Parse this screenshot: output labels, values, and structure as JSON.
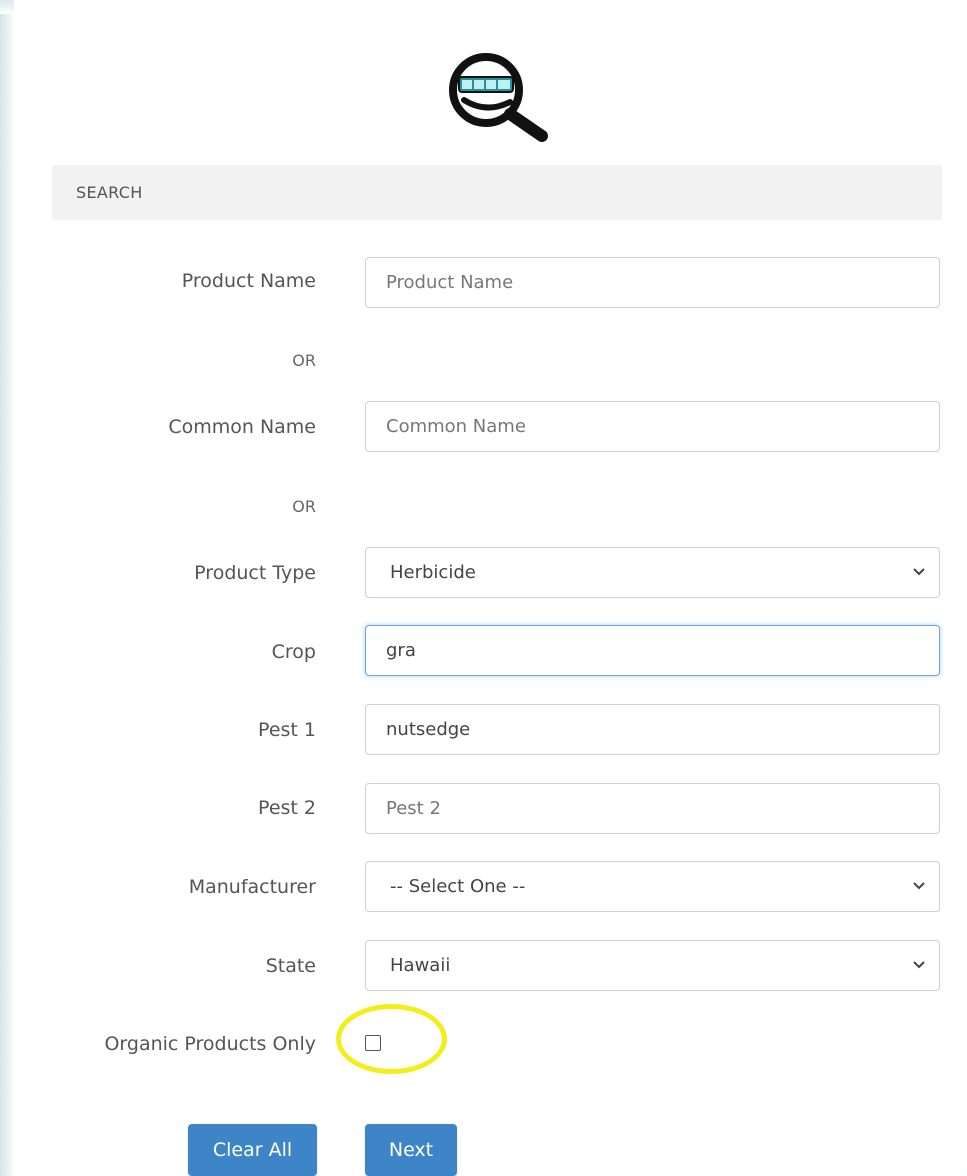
{
  "panel": {
    "title": "SEARCH"
  },
  "fields": {
    "product_name": {
      "label": "Product Name",
      "placeholder": "Product Name",
      "value": ""
    },
    "or_1": "OR",
    "common_name": {
      "label": "Common Name",
      "placeholder": "Common Name",
      "value": ""
    },
    "or_2": "OR",
    "product_type": {
      "label": "Product Type",
      "selected": "Herbicide"
    },
    "crop": {
      "label": "Crop",
      "value": "gra"
    },
    "pest1": {
      "label": "Pest 1",
      "value": "nutsedge"
    },
    "pest2": {
      "label": "Pest 2",
      "placeholder": "Pest 2",
      "value": ""
    },
    "manufacturer": {
      "label": "Manufacturer",
      "selected": "-- Select One --"
    },
    "state": {
      "label": "State",
      "selected": "Hawaii"
    },
    "organic": {
      "label": "Organic Products Only",
      "checked": false
    }
  },
  "buttons": {
    "clear_all": "Clear All",
    "next": "Next"
  },
  "logo": {
    "icon": "magnifier-logo-icon"
  },
  "colors": {
    "button": "#3d85c6",
    "highlight": "#f3ee1a",
    "focus_border": "#6fa8dc",
    "header_bg": "#f2f2f2"
  }
}
